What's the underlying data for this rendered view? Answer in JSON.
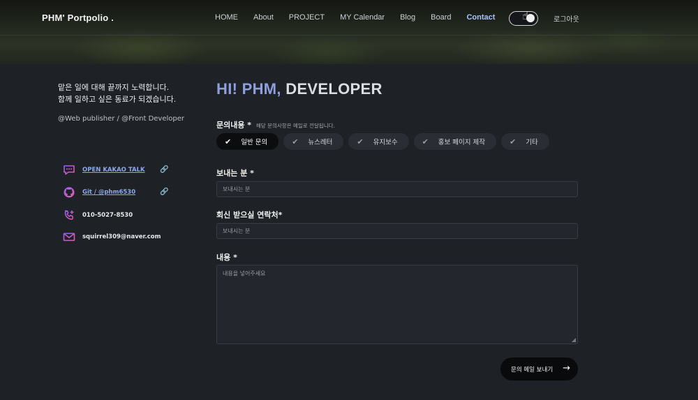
{
  "header": {
    "logo": "PHM' Portpolio .",
    "nav": [
      "HOME",
      "About",
      "PROJECT",
      "MY Calendar",
      "Blog",
      "Board",
      "Contact"
    ],
    "active_nav": "Contact",
    "logout": "로그아웃"
  },
  "profile": {
    "intro_line1": "맡은 일에 대해 끝까지 노력합니다.",
    "intro_line2": "함께 일하고 싶은 동료가 되겠습니다.",
    "role": "@Web publisher / @Front Developer",
    "contacts": [
      {
        "icon": "chat-icon",
        "text": "OPEN KAKAO TALK",
        "link": true
      },
      {
        "icon": "github-icon",
        "text": "Git / @phm6530",
        "link": true
      },
      {
        "icon": "phone-icon",
        "text": "010-5027-8530",
        "link": false
      },
      {
        "icon": "mail-icon",
        "text": "squirrel309@naver.com",
        "link": false
      }
    ]
  },
  "form": {
    "headline_hi": "HI! PHM,",
    "headline_rest": "DEVELOPER",
    "inquiry_label": "문의내용 *",
    "inquiry_note": "해당 문의사항은 메일로 전달됩니다.",
    "chips": [
      "일반 문의",
      "뉴스레터",
      "유지보수",
      "홍보 페이지 제작",
      "기타"
    ],
    "selected_chip": "일반 문의",
    "sender_label": "보내는 분 *",
    "sender_placeholder": "보내시는 분",
    "reply_label": "회신 받으실 연락처*",
    "reply_placeholder": "보내시는 분",
    "content_label": "내용 *",
    "content_placeholder": "내용을 넣어주세요",
    "submit_label": "문의 메일 보내기"
  },
  "colors": {
    "background": "#1e2126",
    "accent_blue": "#8e9fdc",
    "link": "#8ea8e6",
    "icon_gradient_start": "#9b5cf6",
    "icon_gradient_end": "#e55ca8"
  }
}
